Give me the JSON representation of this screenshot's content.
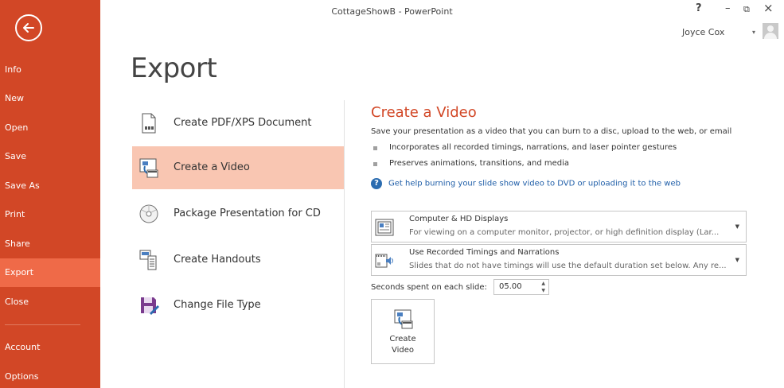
{
  "window": {
    "title": "CottageShowB - PowerPoint",
    "help_glyph": "?",
    "minimize_glyph": "–",
    "restore_glyph": "⧉",
    "close_glyph": "×",
    "user_name": "Joyce Cox",
    "user_caret": "▾"
  },
  "sidebar": {
    "items": [
      {
        "label": "Info"
      },
      {
        "label": "New"
      },
      {
        "label": "Open"
      },
      {
        "label": "Save"
      },
      {
        "label": "Save As"
      },
      {
        "label": "Print"
      },
      {
        "label": "Share"
      },
      {
        "label": "Export",
        "active": true
      },
      {
        "label": "Close"
      },
      {
        "label": "Account"
      },
      {
        "label": "Options"
      }
    ]
  },
  "page": {
    "title": "Export"
  },
  "options": [
    {
      "label": "Create PDF/XPS Document",
      "icon": "pdf-document-icon"
    },
    {
      "label": "Create a Video",
      "icon": "video-icon",
      "active": true
    },
    {
      "label": "Package Presentation for CD",
      "icon": "cd-icon"
    },
    {
      "label": "Create Handouts",
      "icon": "handouts-icon"
    },
    {
      "label": "Change File Type",
      "icon": "file-type-icon"
    }
  ],
  "video_panel": {
    "title": "Create a Video",
    "description": "Save your presentation as a video that you can burn to a disc, upload to the web, or email",
    "bullets": [
      "Incorporates all recorded timings, narrations, and laser pointer gestures",
      "Preserves animations, transitions, and media"
    ],
    "help_link": "Get help burning your slide show video to DVD or uploading it to the web",
    "quality_dropdown": {
      "title": "Computer & HD Displays",
      "subtitle": "For viewing on a computer monitor, projector, or high definition display  (Lar..."
    },
    "timing_dropdown": {
      "title": "Use Recorded Timings and Narrations",
      "subtitle": "Slides that do not have timings will use the default duration set below. Any re..."
    },
    "seconds_label": "Seconds spent on each slide:",
    "seconds_value": "05.00",
    "create_button": {
      "line1": "Create",
      "line2": "Video"
    }
  },
  "colors": {
    "sidebar": "#d24726",
    "sidebar_active": "#ef6a48",
    "option_active": "#f9c6b2",
    "accent_text": "#d24726",
    "link": "#1f5ea8"
  }
}
